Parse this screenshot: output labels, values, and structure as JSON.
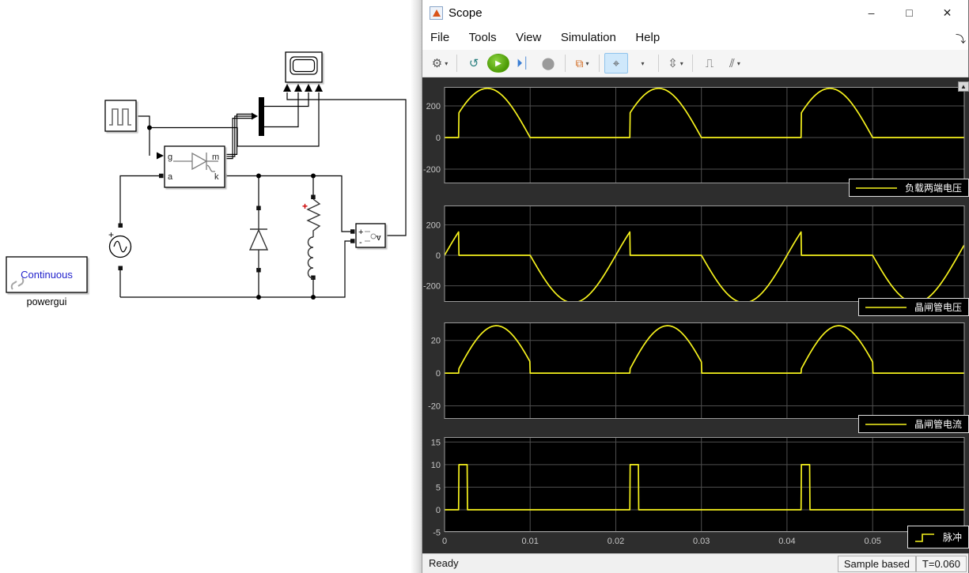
{
  "window": {
    "title": "Scope",
    "menu": [
      "File",
      "Tools",
      "View",
      "Simulation",
      "Help"
    ],
    "controls": {
      "minimize": "–",
      "maximize": "□",
      "close": "✕"
    },
    "menu_overflow_glyph": "⤵"
  },
  "toolbar": {
    "caret": "▾",
    "buttons": [
      {
        "name": "settings-gear",
        "glyph": "⚙",
        "dropdown": true
      },
      {
        "name": "step-back",
        "glyph": "↺",
        "dropdown": false
      },
      {
        "name": "run",
        "glyph": "▶",
        "dropdown": false
      },
      {
        "name": "step-forward",
        "glyph": "⏵⏐",
        "dropdown": false
      },
      {
        "name": "stop",
        "glyph": "⬤",
        "dropdown": false
      },
      {
        "name": "layout",
        "glyph": "⧉",
        "dropdown": true
      },
      {
        "name": "cursor-measurements",
        "glyph": "⌖",
        "dropdown": true
      },
      {
        "name": "autoscale",
        "glyph": "⇳",
        "dropdown": true
      },
      {
        "name": "trigger",
        "glyph": "⎍",
        "dropdown": false
      },
      {
        "name": "measurements-ruler",
        "glyph": "⫽",
        "dropdown": true
      }
    ]
  },
  "status": {
    "left": "Ready",
    "sample": "Sample based",
    "time": "T=0.060"
  },
  "model": {
    "powergui_mode": "Continuous",
    "powergui_label": "powergui",
    "thyristor_ports": {
      "g": "g",
      "a": "a",
      "m": "m",
      "k": "k"
    },
    "vm": {
      "plus": "+",
      "minus": "-",
      "v": "v"
    },
    "source_plus": "+",
    "rl_plus": "+"
  },
  "colors": {
    "trace": "#f6f21d",
    "axes_bg": "#000000",
    "pane_bg": "#2d2d2d",
    "grid": "#4f4f4f",
    "axes_border": "#9a9a9a",
    "tick_text": "#c7c7c7",
    "selected_button_bg": "#cfe8fb",
    "run_green": "#4d9b06",
    "powergui_blue": "#2222cc",
    "rl_plus_red": "#cc0000"
  },
  "chart_data": [
    {
      "type": "line",
      "legend": "负载两端电压",
      "legend_glyph": "line",
      "xlim": [
        0,
        0.0607
      ],
      "ylim": [
        -290,
        320
      ],
      "period": 0.02,
      "yticks": [
        {
          "v": 200,
          "label": "200"
        },
        {
          "v": 0,
          "label": "0"
        },
        {
          "v": -200,
          "label": "-200"
        }
      ],
      "xticks": [
        {
          "v": 0,
          "label": "0"
        },
        {
          "v": 0.01,
          "label": "0.01"
        },
        {
          "v": 0.02,
          "label": "0.02"
        },
        {
          "v": 0.03,
          "label": "0.03"
        },
        {
          "v": 0.04,
          "label": "0.04"
        },
        {
          "v": 0.05,
          "label": "0.05"
        }
      ],
      "show_xticklabels": false,
      "segments": [
        {
          "t0": 0,
          "t1": 0.001667,
          "kind": "const",
          "value": 0
        },
        {
          "t0": 0.001667,
          "t1": 0.01,
          "kind": "sine",
          "amp": 311,
          "freq": 50
        },
        {
          "t0": 0.01,
          "t1": 0.02,
          "kind": "const",
          "value": 0
        }
      ]
    },
    {
      "type": "line",
      "legend": "晶闸管电压",
      "legend_glyph": "line",
      "xlim": [
        0,
        0.0607
      ],
      "ylim": [
        -306,
        327
      ],
      "period": 0.02,
      "yticks": [
        {
          "v": 200,
          "label": "200"
        },
        {
          "v": 0,
          "label": "0"
        },
        {
          "v": -200,
          "label": "-200"
        }
      ],
      "xticks": [
        {
          "v": 0,
          "label": "0"
        },
        {
          "v": 0.01,
          "label": "0.01"
        },
        {
          "v": 0.02,
          "label": "0.02"
        },
        {
          "v": 0.03,
          "label": "0.03"
        },
        {
          "v": 0.04,
          "label": "0.04"
        },
        {
          "v": 0.05,
          "label": "0.05"
        }
      ],
      "show_xticklabels": false,
      "segments": [
        {
          "t0": 0,
          "t1": 0.001667,
          "kind": "sine",
          "amp": 311,
          "freq": 50
        },
        {
          "t0": 0.001667,
          "t1": 0.01,
          "kind": "const",
          "value": 0
        },
        {
          "t0": 0.01,
          "t1": 0.02,
          "kind": "sine",
          "amp": 311,
          "freq": 50
        }
      ]
    },
    {
      "type": "line",
      "legend": "晶闸管电流",
      "legend_glyph": "line",
      "xlim": [
        0,
        0.0607
      ],
      "ylim": [
        -28,
        31
      ],
      "period": 0.02,
      "yticks": [
        {
          "v": 20,
          "label": "20"
        },
        {
          "v": 0,
          "label": "0"
        },
        {
          "v": -20,
          "label": "-20"
        }
      ],
      "xticks": [
        {
          "v": 0,
          "label": "0"
        },
        {
          "v": 0.01,
          "label": "0.01"
        },
        {
          "v": 0.02,
          "label": "0.02"
        },
        {
          "v": 0.03,
          "label": "0.03"
        },
        {
          "v": 0.04,
          "label": "0.04"
        },
        {
          "v": 0.05,
          "label": "0.05"
        }
      ],
      "show_xticklabels": false,
      "segments": [
        {
          "t0": 0,
          "t1": 0.001667,
          "kind": "const",
          "value": 0
        },
        {
          "t0": 0.001667,
          "t1": 0.01,
          "kind": "halfsine",
          "amp": 29,
          "z0": 0.0014,
          "z1": 0.0107
        },
        {
          "t0": 0.01,
          "t1": 0.02,
          "kind": "const",
          "value": 0
        }
      ]
    },
    {
      "type": "line",
      "legend": "脉冲",
      "legend_glyph": "step",
      "xlim": [
        0,
        0.0607
      ],
      "ylim": [
        -4.9,
        16.1
      ],
      "period": 0.02,
      "yticks": [
        {
          "v": 15,
          "label": "15"
        },
        {
          "v": 10,
          "label": "10"
        },
        {
          "v": 5,
          "label": "5"
        },
        {
          "v": 0,
          "label": "0"
        },
        {
          "v": -5,
          "label": "-5"
        }
      ],
      "xticks": [
        {
          "v": 0,
          "label": "0"
        },
        {
          "v": 0.01,
          "label": "0.01"
        },
        {
          "v": 0.02,
          "label": "0.02"
        },
        {
          "v": 0.03,
          "label": "0.03"
        },
        {
          "v": 0.04,
          "label": "0.04"
        },
        {
          "v": 0.05,
          "label": "0.05"
        }
      ],
      "show_xticklabels": true,
      "segments": [
        {
          "t0": 0,
          "t1": 0.001667,
          "kind": "const",
          "value": 0
        },
        {
          "t0": 0.001667,
          "t1": 0.002667,
          "kind": "const",
          "value": 10
        },
        {
          "t0": 0.002667,
          "t1": 0.02,
          "kind": "const",
          "value": 0
        }
      ]
    }
  ]
}
